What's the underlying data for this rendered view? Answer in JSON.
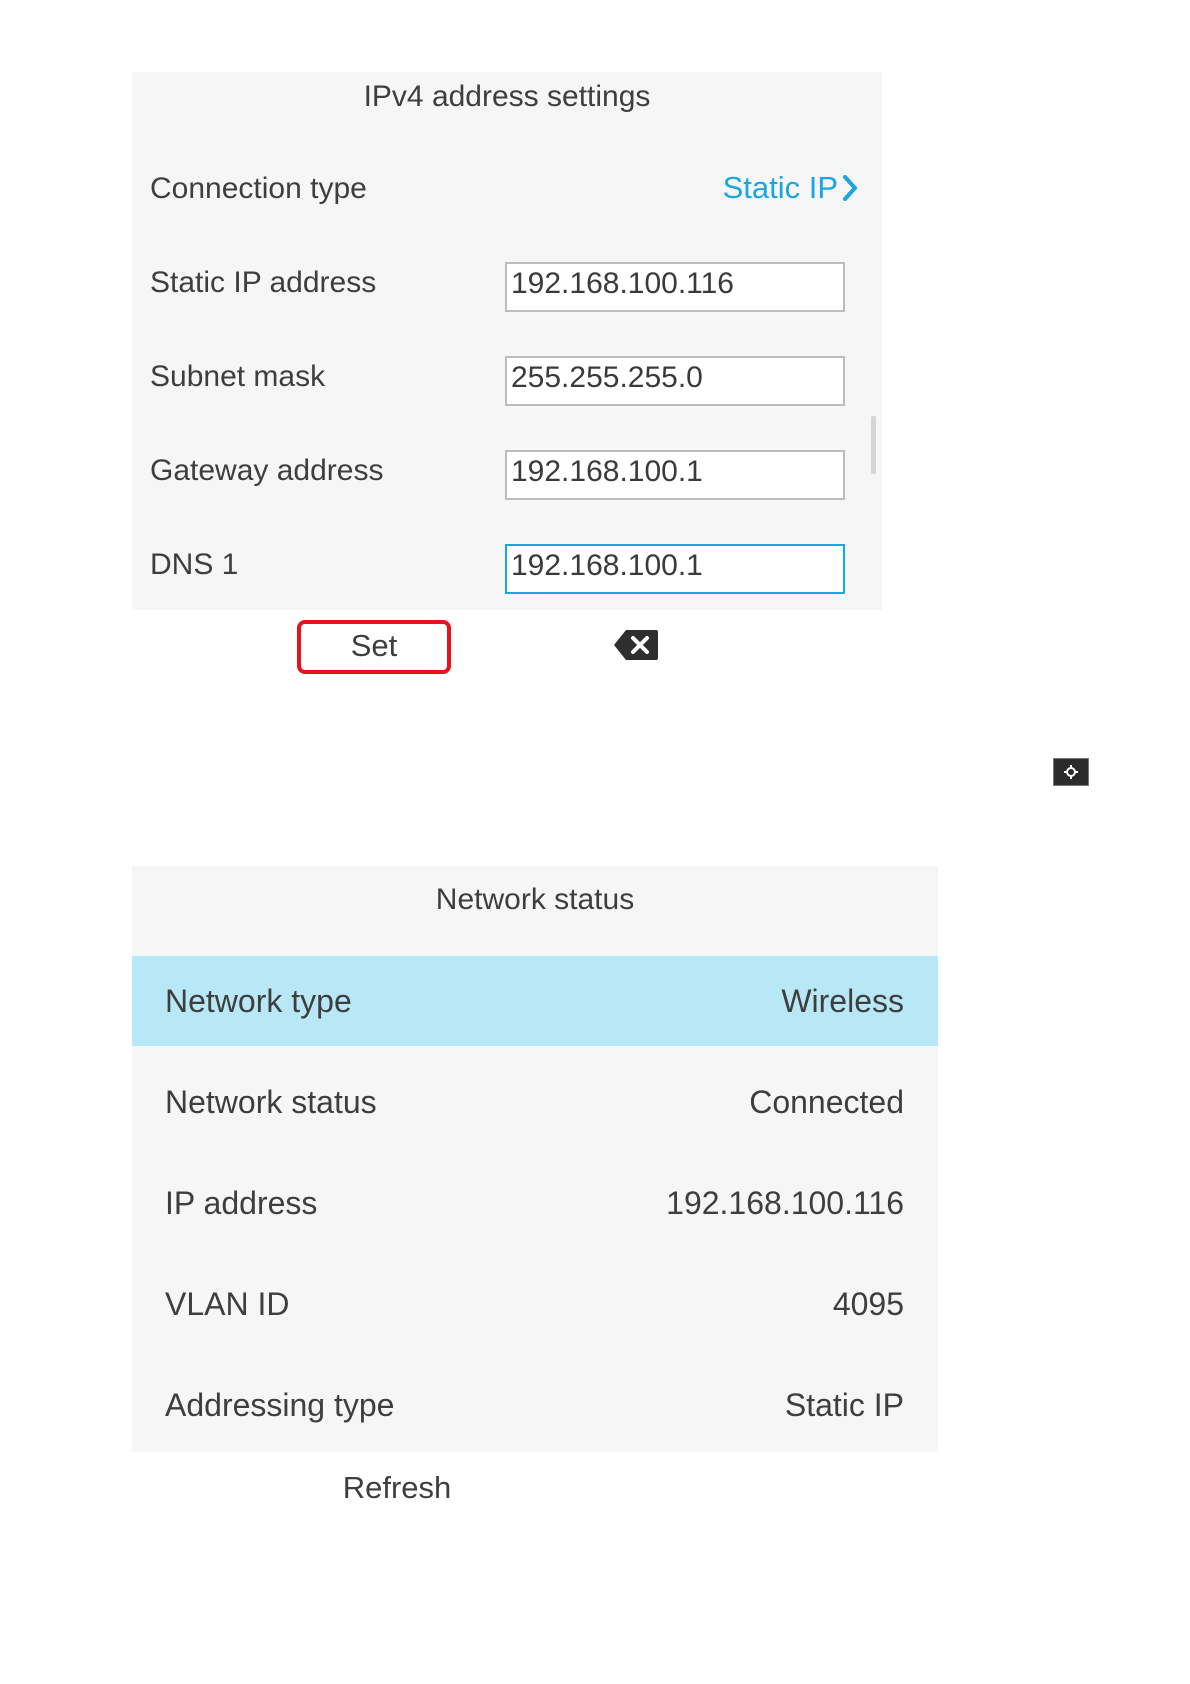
{
  "ipv4": {
    "title": "IPv4 address settings",
    "connection_type_label": "Connection type",
    "connection_type_value": "Static IP",
    "static_ip_label": "Static IP address",
    "static_ip_value": "192.168.100.116",
    "subnet_label": "Subnet mask",
    "subnet_value": "255.255.255.0",
    "gateway_label": "Gateway address",
    "gateway_value": "192.168.100.1",
    "dns1_label": "DNS 1",
    "dns1_value": "192.168.100.1"
  },
  "softkeys": {
    "set_label": "Set",
    "backspace_icon": "backspace-icon",
    "refresh_label": "Refresh"
  },
  "network_status": {
    "title": "Network status",
    "rows": [
      {
        "label": "Network type",
        "value": "Wireless"
      },
      {
        "label": "Network status",
        "value": "Connected"
      },
      {
        "label": "IP address",
        "value": "192.168.100.116"
      },
      {
        "label": "VLAN ID",
        "value": "4095"
      },
      {
        "label": "Addressing type",
        "value": "Static IP"
      }
    ]
  },
  "colors": {
    "accent": "#1ba6e0",
    "highlight": "#e8121c",
    "selected_row": "#b8e8f6",
    "panel_bg": "#f6f6f6"
  }
}
